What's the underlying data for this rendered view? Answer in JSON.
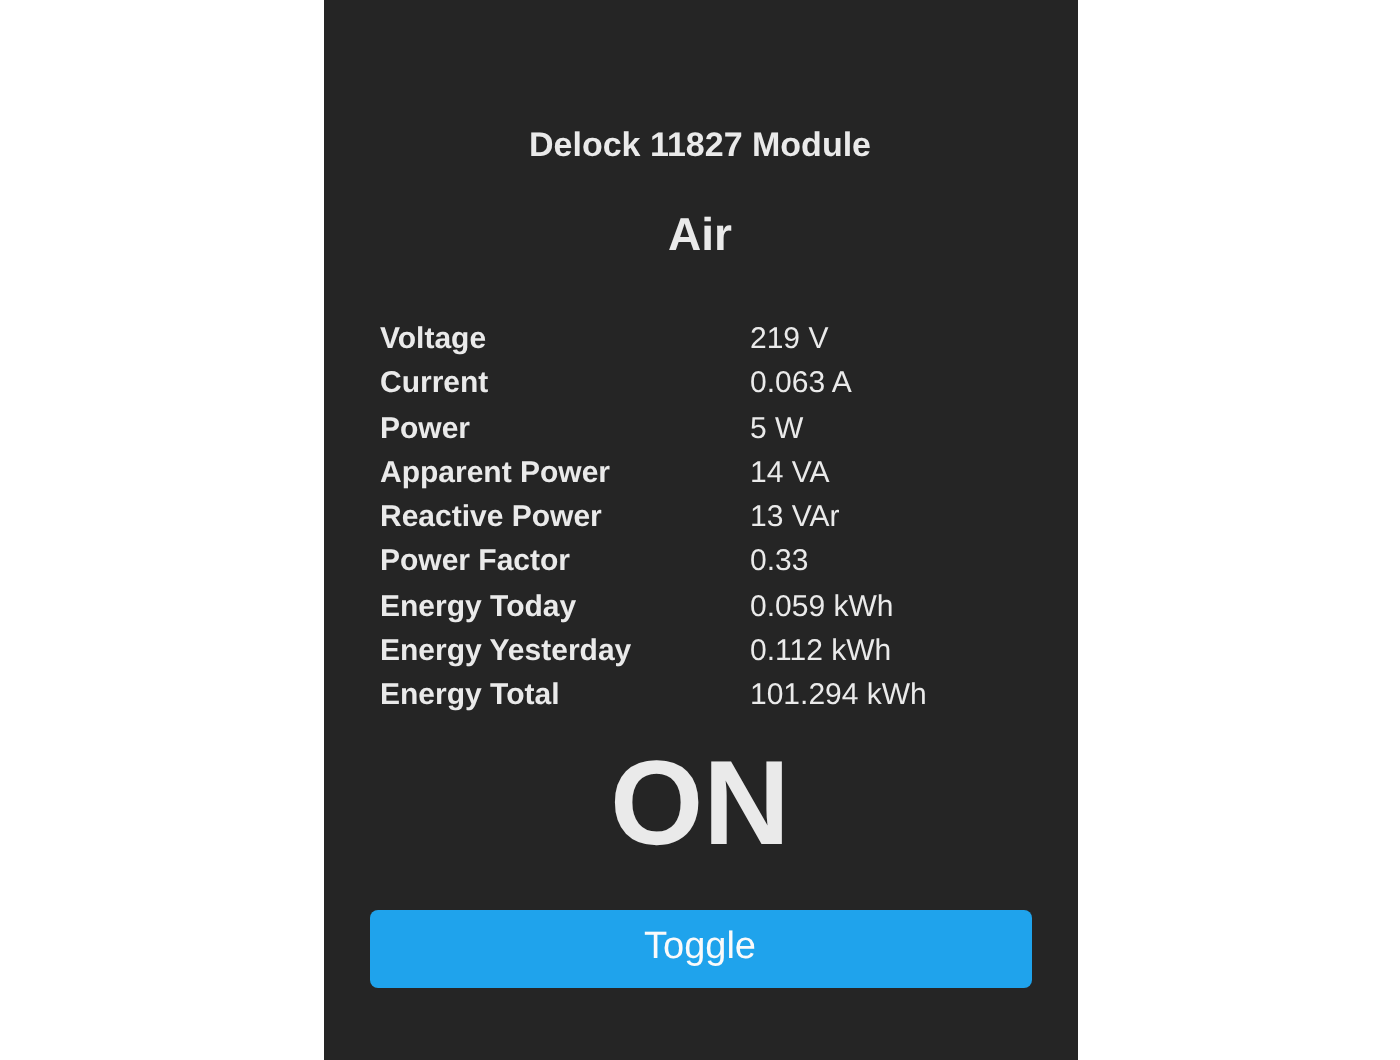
{
  "header": {
    "module": "Delock 11827 Module",
    "device": "Air"
  },
  "readings": [
    {
      "label": "Voltage",
      "value": "219 V"
    },
    {
      "label": "Current",
      "value": "0.063 A"
    },
    {
      "label": "Power",
      "value": "5 W"
    },
    {
      "label": "Apparent Power",
      "value": "14 VA"
    },
    {
      "label": "Reactive Power",
      "value": "13 VAr"
    },
    {
      "label": "Power Factor",
      "value": "0.33"
    },
    {
      "label": "Energy Today",
      "value": "0.059 kWh"
    },
    {
      "label": "Energy Yesterday",
      "value": "0.112 kWh"
    },
    {
      "label": "Energy Total",
      "value": "101.294 kWh"
    }
  ],
  "power_state": "ON",
  "buttons": [
    "Toggle"
  ]
}
